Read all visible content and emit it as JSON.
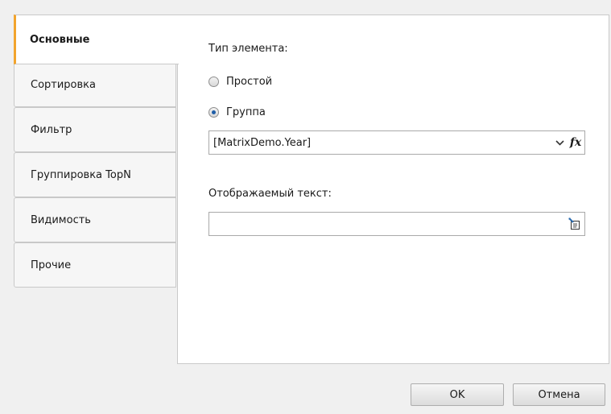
{
  "tabs": [
    {
      "label": "Основные",
      "active": true
    },
    {
      "label": "Сортировка",
      "active": false
    },
    {
      "label": "Фильтр",
      "active": false
    },
    {
      "label": "Группировка TopN",
      "active": false
    },
    {
      "label": "Видимость",
      "active": false
    },
    {
      "label": "Прочие",
      "active": false
    }
  ],
  "main": {
    "element_type_label": "Тип элемента:",
    "radio_simple": "Простой",
    "radio_group": "Группа",
    "selected_option": "Группа",
    "group_field_value": "[MatrixDemo.Year]",
    "fx_label": "fx",
    "display_text_label": "Отображаемый текст:",
    "display_text_value": ""
  },
  "buttons": {
    "ok": "OK",
    "cancel": "Отмена"
  },
  "colors": {
    "active_tab_accent": "#f2a42d",
    "radio_dot": "#1f5ea8"
  }
}
